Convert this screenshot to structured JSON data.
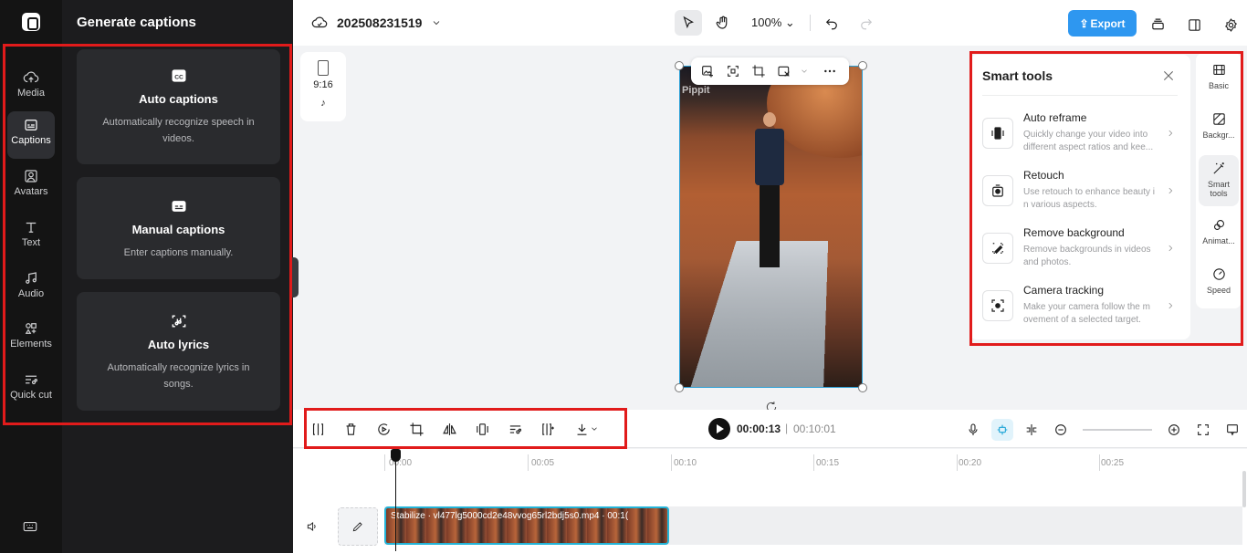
{
  "app": {
    "project_name": "202508231519"
  },
  "rail": {
    "items": [
      {
        "label": "Media"
      },
      {
        "label": "Captions"
      },
      {
        "label": "Avatars"
      },
      {
        "label": "Text"
      },
      {
        "label": "Audio"
      },
      {
        "label": "Elements"
      },
      {
        "label": "Quick cut"
      }
    ]
  },
  "panel": {
    "title": "Generate captions",
    "cards": [
      {
        "title": "Auto captions",
        "desc": "Automatically recognize speech in videos."
      },
      {
        "title": "Manual captions",
        "desc": "Enter captions manually."
      },
      {
        "title": "Auto lyrics",
        "desc": "Automatically recognize lyrics in songs."
      }
    ]
  },
  "topbar": {
    "zoom": "100%",
    "export_label": "Export"
  },
  "canvas": {
    "ratio_label": "9:16",
    "watermark": "Pippit"
  },
  "smart_tools": {
    "title": "Smart tools",
    "tools": [
      {
        "name": "Auto reframe",
        "desc": "Quickly change your video into different aspect ratios and kee..."
      },
      {
        "name": "Retouch",
        "desc": "Use retouch to enhance beauty i n various aspects."
      },
      {
        "name": "Remove background",
        "desc": "Remove backgrounds in videos and photos."
      },
      {
        "name": "Camera tracking",
        "desc": "Make your camera follow the m ovement of a selected target."
      }
    ]
  },
  "right_rail": {
    "items": [
      {
        "label": "Basic"
      },
      {
        "label": "Backgr..."
      },
      {
        "label": "Smart tools"
      },
      {
        "label": "Animat..."
      },
      {
        "label": "Speed"
      }
    ]
  },
  "timeline": {
    "current_time": "00:00:13",
    "separator": "|",
    "total_time": "00:10:01",
    "ruler": [
      "00:00",
      "00:05",
      "00:10",
      "00:15",
      "00:20",
      "00:25"
    ],
    "clip_label": "Stabilize · vl477lg5000cd2e48vvog65rl2bdj5s0.mp4 · 00:1("
  },
  "colors": {
    "accent": "#2e97f0",
    "annotation": "#e11b1b",
    "selection": "#23b4d8"
  }
}
